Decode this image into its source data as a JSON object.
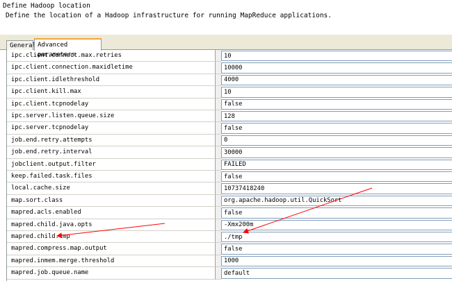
{
  "header": {
    "title": "Define Hadoop location",
    "description": "Define the location of a Hadoop infrastructure for running MapReduce applications."
  },
  "tabs": [
    {
      "label": "General"
    },
    {
      "label": "Advanced parameters"
    }
  ],
  "params": [
    {
      "key": "ipc.client.connect.max.retries",
      "value": "10"
    },
    {
      "key": "ipc.client.connection.maxidletime",
      "value": "10000"
    },
    {
      "key": "ipc.client.idlethreshold",
      "value": "4000"
    },
    {
      "key": "ipc.client.kill.max",
      "value": "10"
    },
    {
      "key": "ipc.client.tcpnodelay",
      "value": "false"
    },
    {
      "key": "ipc.server.listen.queue.size",
      "value": "128"
    },
    {
      "key": "ipc.server.tcpnodelay",
      "value": "false"
    },
    {
      "key": "job.end.retry.attempts",
      "value": "0"
    },
    {
      "key": "job.end.retry.interval",
      "value": "30000"
    },
    {
      "key": "jobclient.output.filter",
      "value": "FAILED"
    },
    {
      "key": "keep.failed.task.files",
      "value": "false"
    },
    {
      "key": "local.cache.size",
      "value": "10737418240"
    },
    {
      "key": "map.sort.class",
      "value": "org.apache.hadoop.util.QuickSort"
    },
    {
      "key": "mapred.acls.enabled",
      "value": "false"
    },
    {
      "key": "mapred.child.java.opts",
      "value": "-Xmx200m"
    },
    {
      "key": "mapred.child.tmp",
      "value": "./tmp"
    },
    {
      "key": "mapred.compress.map.output",
      "value": "false"
    },
    {
      "key": "mapred.inmem.merge.threshold",
      "value": "1000"
    },
    {
      "key": "mapred.job.queue.name",
      "value": "default"
    }
  ],
  "colors": {
    "arrow": "#ff0000",
    "active_tab_accent": "#f4a43b"
  }
}
